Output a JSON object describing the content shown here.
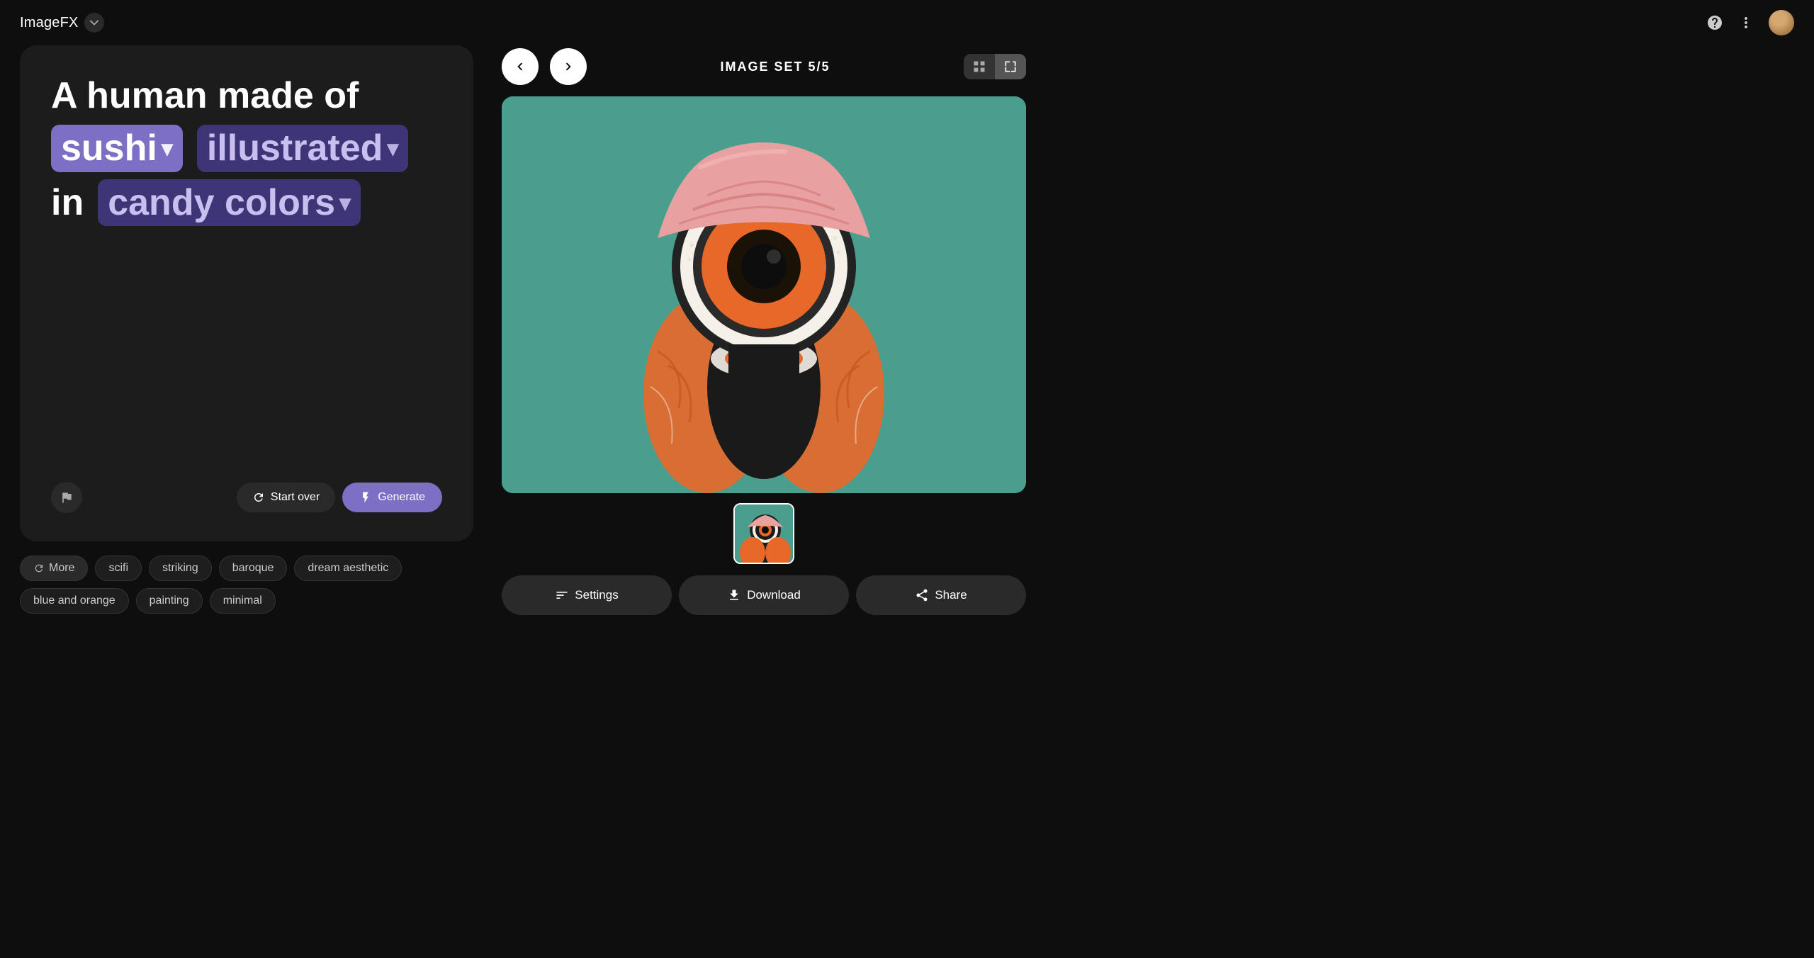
{
  "app": {
    "title": "ImageFX",
    "badge_symbol": "●"
  },
  "header": {
    "help_icon": "?",
    "more_icon": "⋮"
  },
  "prompt": {
    "line1_plain": "A human made of",
    "chip1_label": "sushi",
    "chip2_label": "illustrated",
    "line2_plain": "in",
    "chip3_label": "candy colors"
  },
  "buttons": {
    "start_over": "Start over",
    "generate": "Generate",
    "flag_title": "Report",
    "settings": "Settings",
    "download": "Download",
    "share": "Share"
  },
  "image_nav": {
    "image_set_label": "IMAGE SET 5/5"
  },
  "suggestions": [
    {
      "id": "more",
      "label": "More",
      "has_icon": true
    },
    {
      "id": "scifi",
      "label": "scifi",
      "has_icon": false
    },
    {
      "id": "striking",
      "label": "striking",
      "has_icon": false
    },
    {
      "id": "baroque",
      "label": "baroque",
      "has_icon": false
    },
    {
      "id": "dream-aesthetic",
      "label": "dream aesthetic",
      "has_icon": false
    },
    {
      "id": "blue-and-orange",
      "label": "blue and orange",
      "has_icon": false
    },
    {
      "id": "painting",
      "label": "painting",
      "has_icon": false
    },
    {
      "id": "minimal",
      "label": "minimal",
      "has_icon": false
    }
  ]
}
